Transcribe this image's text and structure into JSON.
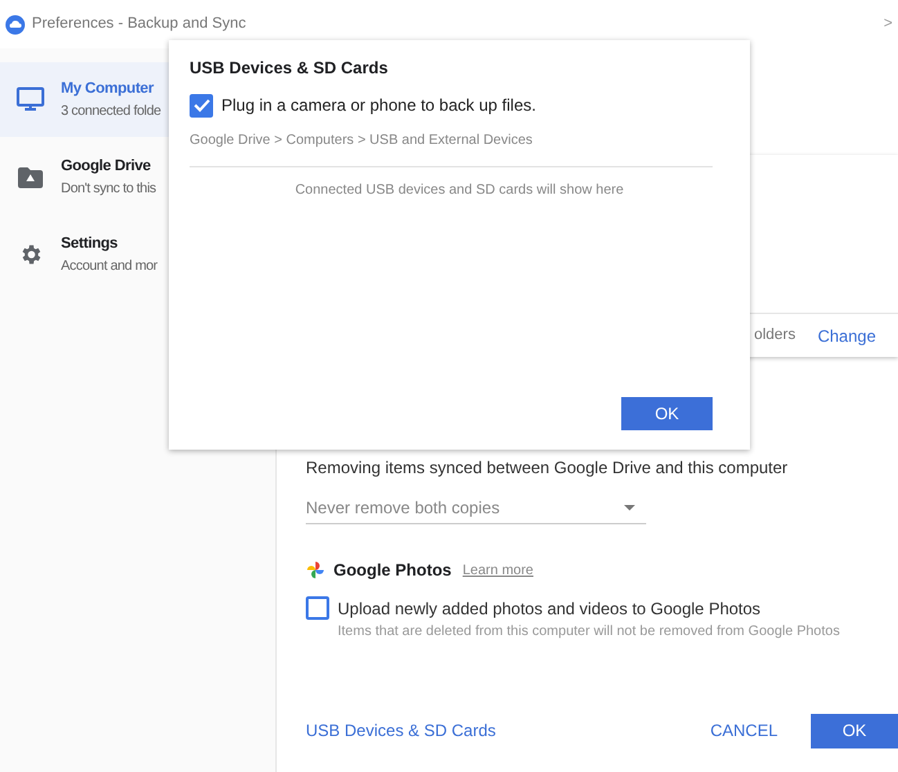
{
  "window": {
    "title": "Preferences - Backup and Sync",
    "edge_glyph": ">"
  },
  "sidebar": {
    "items": [
      {
        "kind": "computer",
        "title": "My Computer",
        "subtitle": "3 connected folde",
        "selected": true
      },
      {
        "kind": "drive",
        "title": "Google Drive",
        "subtitle": "Don't sync to this",
        "selected": false
      },
      {
        "kind": "settings",
        "title": "Settings",
        "subtitle": "Account and mor",
        "selected": false
      }
    ]
  },
  "folders_card": {
    "summary": "olders",
    "action": "Change"
  },
  "removal": {
    "label": "Removing items synced between Google Drive and this computer",
    "value": "Never remove both copies"
  },
  "photos": {
    "title": "Google Photos",
    "link": "Learn more",
    "option": {
      "label": "Upload newly added photos and videos to Google Photos",
      "hint": "Items that are deleted from this computer will not be removed from Google Photos",
      "checked": false
    }
  },
  "footer": {
    "link": "USB Devices & SD Cards",
    "cancel": "CANCEL",
    "ok": "OK"
  },
  "dialog": {
    "title": "USB Devices & SD Cards",
    "option": {
      "label": "Plug in a camera or phone to back up files.",
      "checked": true
    },
    "path": "Google Drive > Computers > USB and External Devices",
    "empty": "Connected USB devices and SD cards will show here",
    "ok": "OK"
  }
}
